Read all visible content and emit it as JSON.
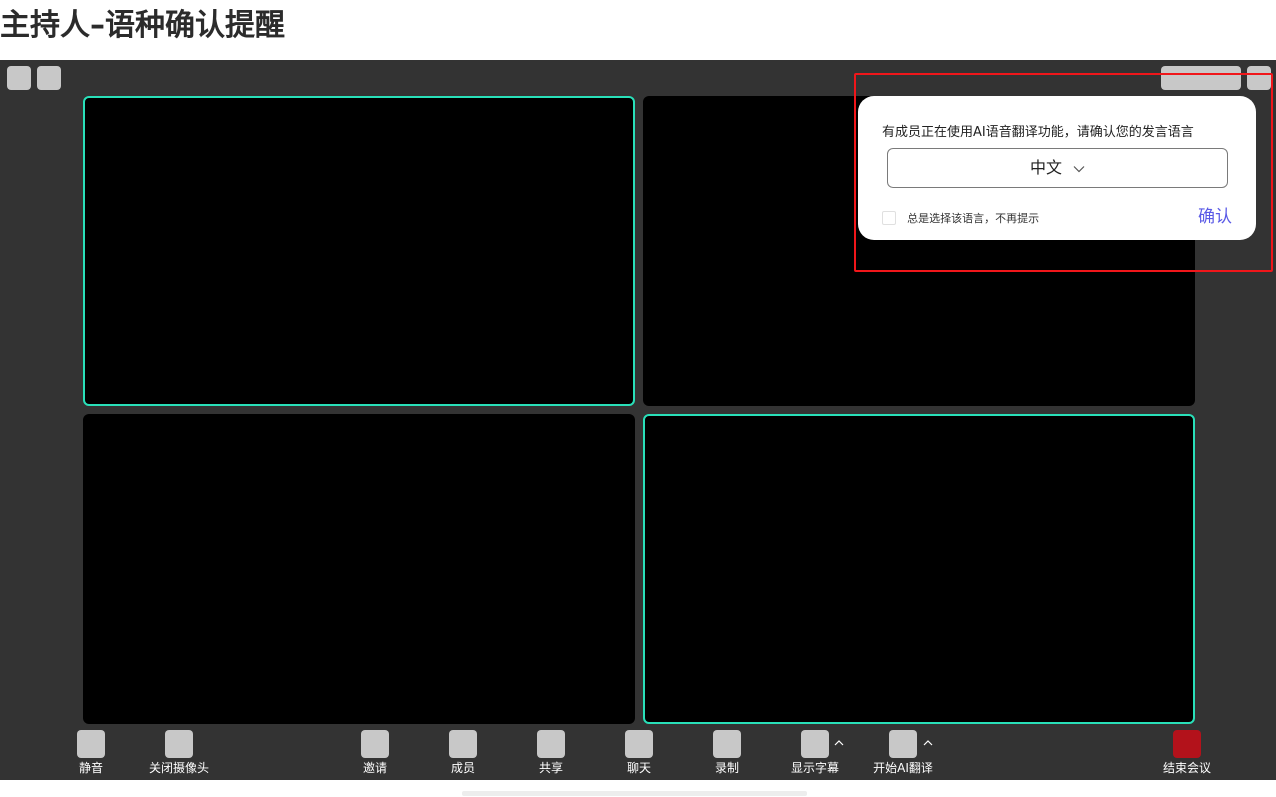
{
  "page": {
    "title": "主持人–语种确认提醒"
  },
  "toolbar": {
    "mute_label": "静音",
    "camera_label": "关闭摄像头",
    "invite_label": "邀请",
    "members_label": "成员",
    "share_label": "共享",
    "chat_label": "聊天",
    "record_label": "录制",
    "captions_label": "显示字幕",
    "ai_translate_label": "开始AI翻译",
    "end_label": "结束会议"
  },
  "dialog": {
    "message": "有成员正在使用AI语音翻译功能，请确认您的发言语言",
    "selected_language": "中文",
    "always_label": "总是选择该语言，不再提示",
    "always_checked": false,
    "confirm_label": "确认"
  },
  "icons": {
    "select_chevron": "chevron-down-icon",
    "caret": "caret-up-icon"
  },
  "colors": {
    "stage_bg": "#333333",
    "active_speaker_border": "#29e0b9",
    "end_button": "#b3121b",
    "confirm_text": "#5a5ae6",
    "highlight_border": "#f0161a"
  }
}
